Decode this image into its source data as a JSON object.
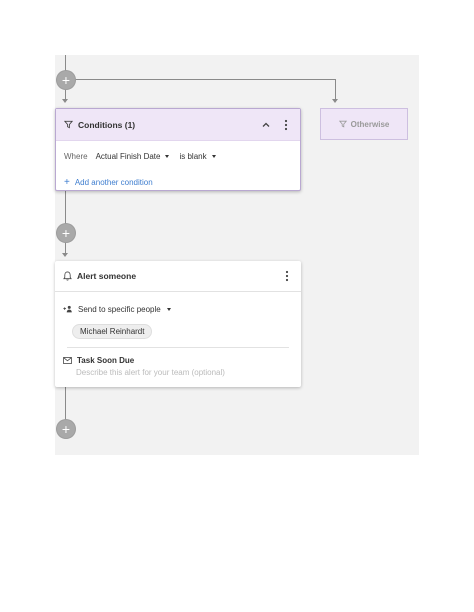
{
  "conditions_card": {
    "title": "Conditions (1)",
    "where_label": "Where",
    "field_value": "Actual Finish Date",
    "operator_value": "is blank",
    "add_condition_label": "Add another condition"
  },
  "otherwise_card": {
    "title": "Otherwise"
  },
  "alert_card": {
    "title": "Alert someone",
    "recipient_mode": "Send to specific people",
    "recipient_chip": "Michael Reinhardt",
    "message_title": "Task Soon Due",
    "message_placeholder": "Describe this alert for your team (optional)"
  },
  "flow": {
    "add_step_symbol": "+"
  },
  "colors": {
    "accent_link": "#3f7ecf",
    "condition_header_bg": "#efe6f7",
    "canvas_bg": "#f2f2f2",
    "connector": "#8a8a8a"
  }
}
